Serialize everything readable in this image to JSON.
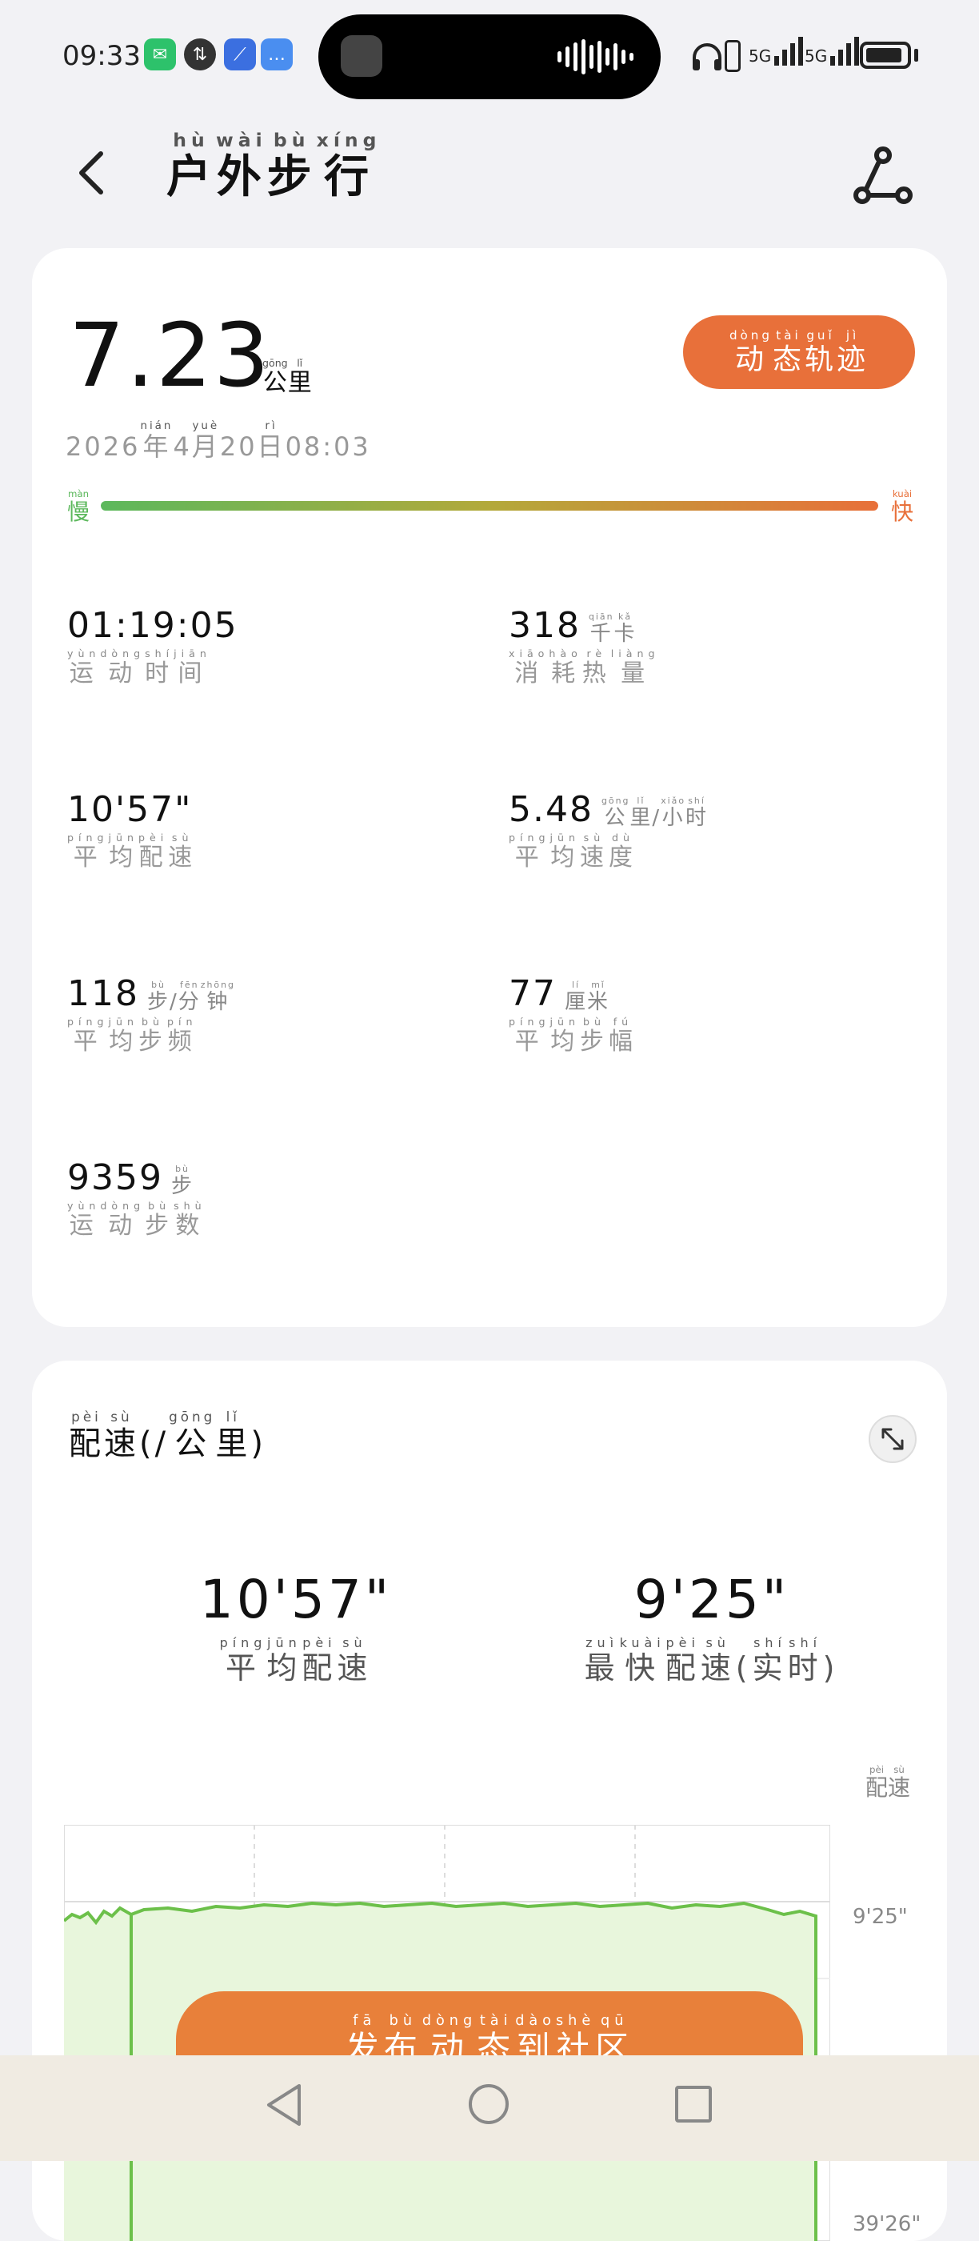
{
  "status_bar": {
    "time": "09:33",
    "network_1": "5G",
    "network_2": "5G"
  },
  "header": {
    "title": [
      {
        "py": "hù",
        "hz": "户"
      },
      {
        "py": "wài",
        "hz": "外"
      },
      {
        "py": "bù",
        "hz": "步"
      },
      {
        "py": "xíng",
        "hz": "行"
      }
    ]
  },
  "summary": {
    "distance": "7.23",
    "distance_unit": [
      {
        "py": "gōng",
        "hz": "公"
      },
      {
        "py": "lǐ",
        "hz": "里"
      }
    ],
    "track_button": [
      {
        "py": "dòng",
        "hz": "动"
      },
      {
        "py": "tài",
        "hz": "态"
      },
      {
        "py": "guǐ",
        "hz": "轨"
      },
      {
        "py": "jì",
        "hz": "迹"
      }
    ],
    "date": [
      {
        "py": "",
        "hz": "2026 "
      },
      {
        "py": "nián",
        "hz": "年"
      },
      {
        "py": "",
        "hz": " 4 "
      },
      {
        "py": "yuè",
        "hz": "月"
      },
      {
        "py": "",
        "hz": " 20 "
      },
      {
        "py": "rì",
        "hz": "日"
      },
      {
        "py": "",
        "hz": " 08:03"
      }
    ],
    "slow_label": [
      {
        "py": "màn",
        "hz": "慢"
      }
    ],
    "fast_label": [
      {
        "py": "kuài",
        "hz": "快"
      }
    ],
    "accent_color": "#e8703a",
    "slow_color": "#5cb85c"
  },
  "stats": [
    {
      "value": "01:19:05",
      "unit": [],
      "label": [
        {
          "py": "yùn",
          "hz": "运"
        },
        {
          "py": "dòng",
          "hz": "动"
        },
        {
          "py": "shí",
          "hz": "时"
        },
        {
          "py": "jiān",
          "hz": "间"
        }
      ]
    },
    {
      "value": "318",
      "unit": [
        {
          "py": "qiān",
          "hz": "千"
        },
        {
          "py": "kǎ",
          "hz": "卡"
        }
      ],
      "label": [
        {
          "py": "xiāo",
          "hz": "消"
        },
        {
          "py": "hào",
          "hz": "耗"
        },
        {
          "py": "rè",
          "hz": "热"
        },
        {
          "py": "liàng",
          "hz": "量"
        }
      ]
    },
    {
      "value": "10'57\"",
      "unit": [],
      "label": [
        {
          "py": "píng",
          "hz": "平"
        },
        {
          "py": "jūn",
          "hz": "均"
        },
        {
          "py": "pèi",
          "hz": "配"
        },
        {
          "py": "sù",
          "hz": "速"
        }
      ]
    },
    {
      "value": "5.48",
      "unit": [
        {
          "py": "gōng",
          "hz": "公"
        },
        {
          "py": "lǐ",
          "hz": "里"
        },
        {
          "py": "",
          "hz": "/"
        },
        {
          "py": "xiǎo",
          "hz": "小"
        },
        {
          "py": "shí",
          "hz": "时"
        }
      ],
      "label": [
        {
          "py": "píng",
          "hz": "平"
        },
        {
          "py": "jūn",
          "hz": "均"
        },
        {
          "py": "sù",
          "hz": "速"
        },
        {
          "py": "dù",
          "hz": "度"
        }
      ]
    },
    {
      "value": "118",
      "unit": [
        {
          "py": "bù",
          "hz": "步"
        },
        {
          "py": "",
          "hz": "/"
        },
        {
          "py": "fēn",
          "hz": "分"
        },
        {
          "py": "zhōng",
          "hz": "钟"
        }
      ],
      "label": [
        {
          "py": "píng",
          "hz": "平"
        },
        {
          "py": "jūn",
          "hz": "均"
        },
        {
          "py": "bù",
          "hz": "步"
        },
        {
          "py": "pín",
          "hz": "频"
        }
      ]
    },
    {
      "value": "77",
      "unit": [
        {
          "py": "lí",
          "hz": "厘"
        },
        {
          "py": "mǐ",
          "hz": "米"
        }
      ],
      "label": [
        {
          "py": "píng",
          "hz": "平"
        },
        {
          "py": "jūn",
          "hz": "均"
        },
        {
          "py": "bù",
          "hz": "步"
        },
        {
          "py": "fú",
          "hz": "幅"
        }
      ]
    },
    {
      "value": "9359",
      "unit": [
        {
          "py": "bù",
          "hz": "步"
        }
      ],
      "label": [
        {
          "py": "yùn",
          "hz": "运"
        },
        {
          "py": "dòng",
          "hz": "动"
        },
        {
          "py": "bù",
          "hz": "步"
        },
        {
          "py": "shù",
          "hz": "数"
        }
      ]
    }
  ],
  "pace_card": {
    "title": [
      {
        "py": "pèi",
        "hz": "配"
      },
      {
        "py": "sù",
        "hz": "速"
      },
      {
        "py": "",
        "hz": "(/"
      },
      {
        "py": "gōng",
        "hz": "公"
      },
      {
        "py": "lǐ",
        "hz": "里"
      },
      {
        "py": "",
        "hz": ")"
      }
    ],
    "avg_value": "10'57\"",
    "avg_label": [
      {
        "py": "píng",
        "hz": "平"
      },
      {
        "py": "jūn",
        "hz": "均"
      },
      {
        "py": "pèi",
        "hz": "配"
      },
      {
        "py": "sù",
        "hz": "速"
      }
    ],
    "best_value": "9'25\"",
    "best_label": [
      {
        "py": "zuì",
        "hz": "最"
      },
      {
        "py": "kuài",
        "hz": "快"
      },
      {
        "py": "pèi",
        "hz": "配"
      },
      {
        "py": "sù",
        "hz": "速"
      },
      {
        "py": "",
        "hz": "("
      },
      {
        "py": "shí",
        "hz": "实"
      },
      {
        "py": "shí",
        "hz": "时"
      },
      {
        "py": "",
        "hz": ")"
      }
    ],
    "chart_ylabel": [
      {
        "py": "pèi",
        "hz": "配"
      },
      {
        "py": "sù",
        "hz": "速"
      }
    ],
    "ticks": [
      "9'25\"",
      "39'26\""
    ],
    "fab": [
      {
        "py": "fā",
        "hz": "发"
      },
      {
        "py": "bù",
        "hz": "布"
      },
      {
        "py": "dòng",
        "hz": "动"
      },
      {
        "py": "tài",
        "hz": "态"
      },
      {
        "py": "dào",
        "hz": "到"
      },
      {
        "py": "shè",
        "hz": "社"
      },
      {
        "py": "qū",
        "hz": "区"
      }
    ]
  },
  "chart_data": {
    "type": "area",
    "ylabel": "配速",
    "y_ticks": [
      "9'25\"",
      "39'26\""
    ],
    "series_color": "#6cc04a",
    "fill_color": "#e8f6dc",
    "grid": true
  }
}
